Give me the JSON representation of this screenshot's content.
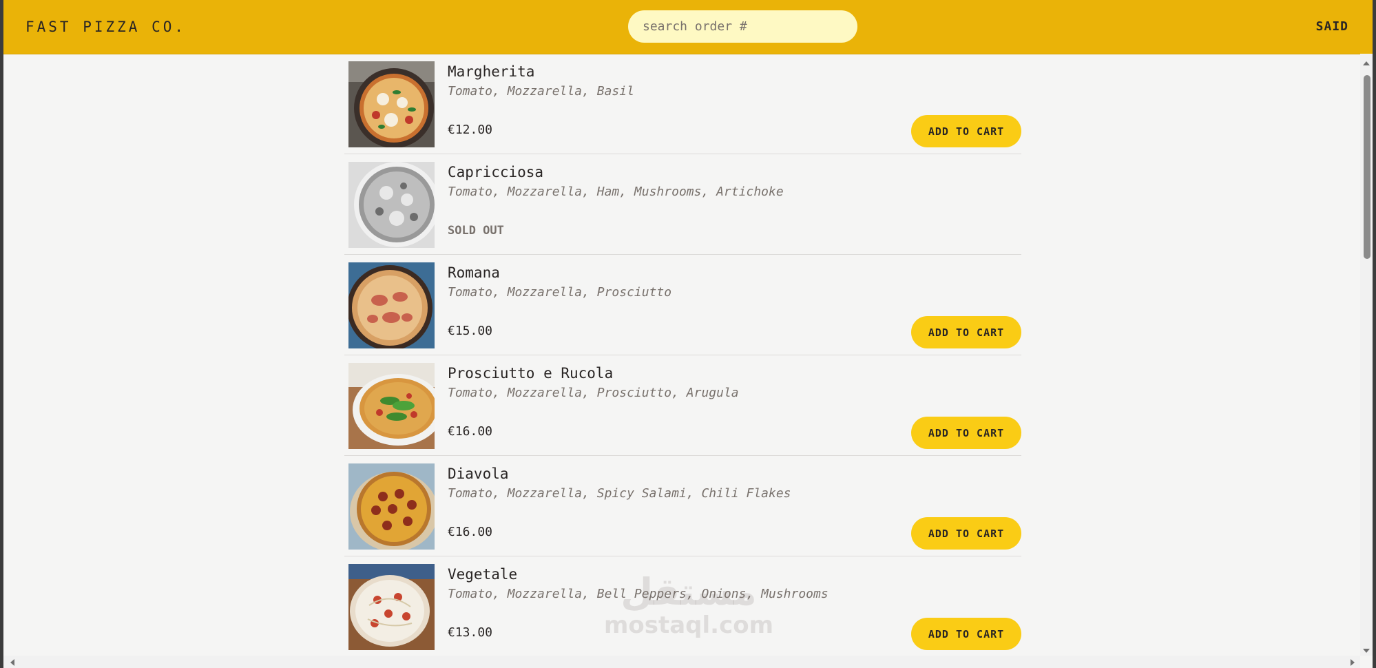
{
  "header": {
    "logo": "FAST PIZZA CO.",
    "search_placeholder": "search order #",
    "username": "SAID"
  },
  "menu": {
    "add_to_cart_label": "ADD TO CART",
    "sold_out_label": "SOLD OUT",
    "items": [
      {
        "name": "Margherita",
        "ingredients": "Tomato, Mozzarella, Basil",
        "price": "€12.00",
        "sold_out": false
      },
      {
        "name": "Capricciosa",
        "ingredients": "Tomato, Mozzarella, Ham, Mushrooms, Artichoke",
        "price": "",
        "sold_out": true
      },
      {
        "name": "Romana",
        "ingredients": "Tomato, Mozzarella, Prosciutto",
        "price": "€15.00",
        "sold_out": false
      },
      {
        "name": "Prosciutto e Rucola",
        "ingredients": "Tomato, Mozzarella, Prosciutto, Arugula",
        "price": "€16.00",
        "sold_out": false
      },
      {
        "name": "Diavola",
        "ingredients": "Tomato, Mozzarella, Spicy Salami, Chili Flakes",
        "price": "€16.00",
        "sold_out": false
      },
      {
        "name": "Vegetale",
        "ingredients": "Tomato, Mozzarella, Bell Peppers, Onions, Mushrooms",
        "price": "€13.00",
        "sold_out": false
      }
    ]
  },
  "watermark": {
    "arabic": "مستقل",
    "latin": "mostaql.com"
  },
  "colors": {
    "header_bg": "#eab308",
    "search_bg": "#fef9c3",
    "button_bg": "#facc15",
    "page_bg": "#f5f5f4"
  }
}
